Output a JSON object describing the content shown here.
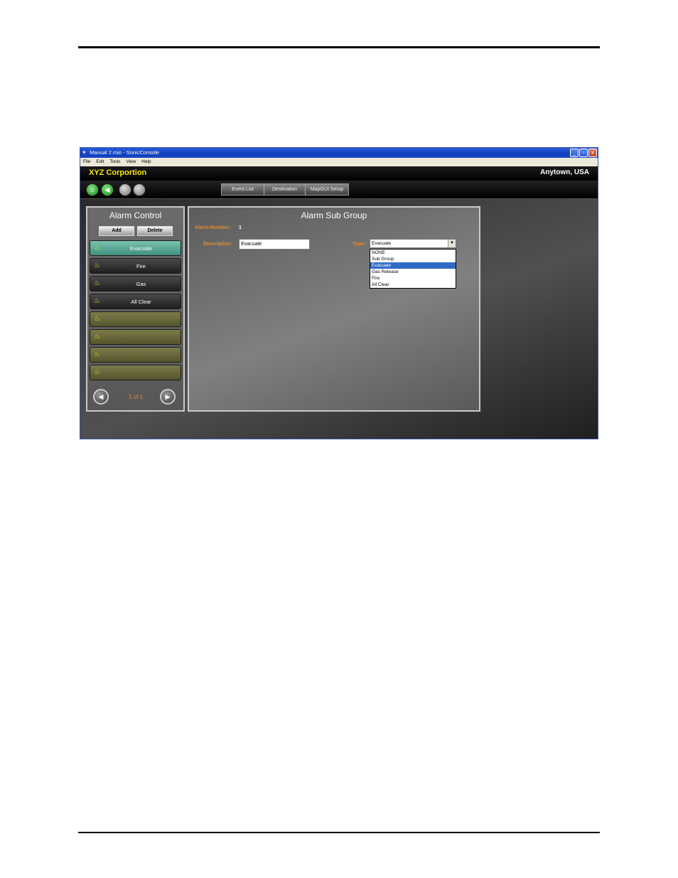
{
  "window": {
    "title": "Manual 2.mio - SonicConsole",
    "minimize_glyph": "_",
    "maximize_glyph": "▫",
    "close_glyph": "x"
  },
  "menu": [
    "File",
    "Edit",
    "Tools",
    "View",
    "Help"
  ],
  "header": {
    "company": "XYZ Corportion",
    "location": "Anytown, USA",
    "company_color": "#f5e600"
  },
  "toolbar": {
    "round_buttons": [
      "home-icon",
      "back-arrow-icon",
      "gray-button-1",
      "gray-button-2"
    ],
    "tabs": [
      "Event List",
      "Destination",
      "MapGUI Setup"
    ]
  },
  "alarm_control": {
    "title": "Alarm Control",
    "add_label": "Add",
    "delete_label": "Delete",
    "items": [
      {
        "label": "Evacuate",
        "state": "selected"
      },
      {
        "label": "Fire",
        "state": "filled"
      },
      {
        "label": "Gas",
        "state": "filled"
      },
      {
        "label": "All Clear",
        "state": "filled"
      },
      {
        "label": "",
        "state": "empty"
      },
      {
        "label": "",
        "state": "empty"
      },
      {
        "label": "",
        "state": "empty"
      },
      {
        "label": "",
        "state": "empty"
      }
    ],
    "page_indicator": "1 of 1",
    "item_icon": "siren-icon"
  },
  "sub_group": {
    "title": "Alarm Sub Group",
    "alarm_number_label": "Alarm Number:",
    "alarm_number_value": "1",
    "description_label": "Description:",
    "description_value": "Evacuate",
    "type_label": "Type:",
    "type_value": "Evacuate",
    "type_options": [
      "NONE",
      "Sub Group",
      "Evacuate",
      "Gas Release",
      "Fire",
      "All Clear"
    ],
    "type_highlighted": "Evacuate"
  },
  "colors": {
    "accent_orange": "#e58a2e",
    "selection_blue": "#316ac5",
    "selected_item_teal": "#5aa897"
  }
}
